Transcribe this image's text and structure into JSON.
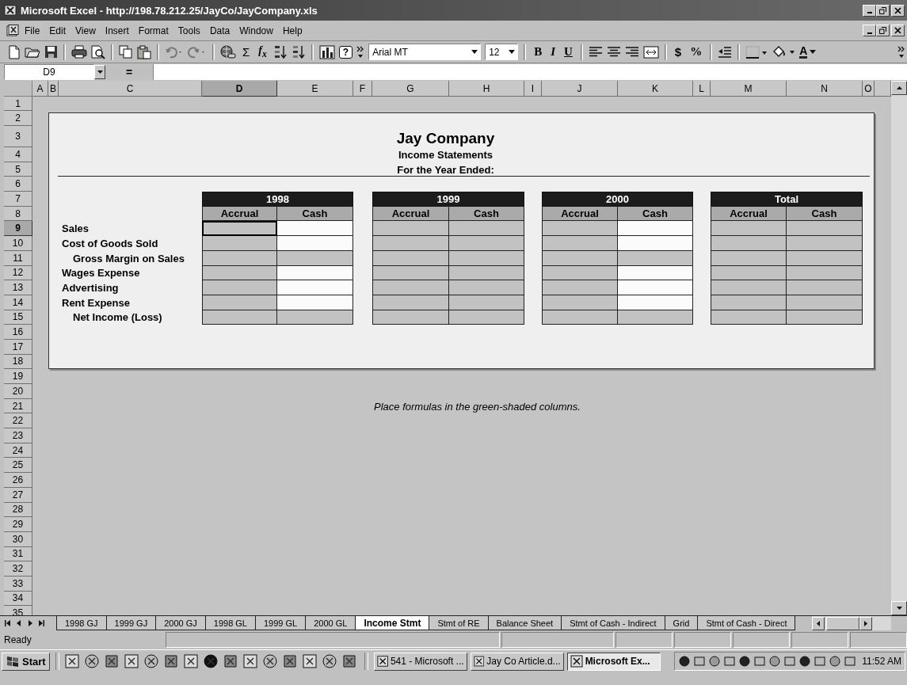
{
  "window": {
    "title": "Microsoft Excel - http://198.78.212.25/JayCo/JayCompany.xls"
  },
  "menu": [
    "File",
    "Edit",
    "View",
    "Insert",
    "Format",
    "Tools",
    "Data",
    "Window",
    "Help"
  ],
  "toolbar": {
    "sum": "Σ",
    "function": "f$_{x}$",
    "help": "?",
    "font": "Arial MT",
    "size": "12",
    "bold": "B",
    "italic": "I",
    "underline": "U",
    "currency": "$",
    "percent": "%",
    "font_color": "A"
  },
  "formula_bar": {
    "name_box": "D9",
    "equals": "="
  },
  "columns": [
    {
      "label": "A",
      "selected": false
    },
    {
      "label": "B",
      "selected": false
    },
    {
      "label": "C",
      "selected": false
    },
    {
      "label": "D",
      "selected": true
    },
    {
      "label": "E",
      "selected": false
    },
    {
      "label": "F",
      "selected": false
    },
    {
      "label": "G",
      "selected": false
    },
    {
      "label": "H",
      "selected": false
    },
    {
      "label": "I",
      "selected": false
    },
    {
      "label": "J",
      "selected": false
    },
    {
      "label": "K",
      "selected": false
    },
    {
      "label": "L",
      "selected": false
    },
    {
      "label": "M",
      "selected": false
    },
    {
      "label": "N",
      "selected": false
    },
    {
      "label": "O",
      "selected": false
    }
  ],
  "rows": [
    {
      "label": "1",
      "selected": false
    },
    {
      "label": "2",
      "selected": false
    },
    {
      "label": "3",
      "selected": false
    },
    {
      "label": "4",
      "selected": false
    },
    {
      "label": "5",
      "selected": false
    },
    {
      "label": "6",
      "selected": false
    },
    {
      "label": "7",
      "selected": false
    },
    {
      "label": "8",
      "selected": false
    },
    {
      "label": "9",
      "selected": true
    },
    {
      "label": "10",
      "selected": false
    },
    {
      "label": "11",
      "selected": false
    },
    {
      "label": "12",
      "selected": false
    },
    {
      "label": "13",
      "selected": false
    },
    {
      "label": "14",
      "selected": false
    },
    {
      "label": "15",
      "selected": false
    },
    {
      "label": "16",
      "selected": false
    },
    {
      "label": "17",
      "selected": false
    },
    {
      "label": "18",
      "selected": false
    },
    {
      "label": "19",
      "selected": false
    },
    {
      "label": "20",
      "selected": false
    },
    {
      "label": "21",
      "selected": false
    },
    {
      "label": "22",
      "selected": false
    },
    {
      "label": "23",
      "selected": false
    },
    {
      "label": "24",
      "selected": false
    },
    {
      "label": "25",
      "selected": false
    },
    {
      "label": "26",
      "selected": false
    },
    {
      "label": "27",
      "selected": false
    },
    {
      "label": "28",
      "selected": false
    },
    {
      "label": "29",
      "selected": false
    },
    {
      "label": "30",
      "selected": false
    },
    {
      "label": "31",
      "selected": false
    },
    {
      "label": "32",
      "selected": false
    },
    {
      "label": "33",
      "selected": false
    },
    {
      "label": "34",
      "selected": false
    },
    {
      "label": "35",
      "selected": false
    }
  ],
  "report": {
    "title": "Jay Company",
    "subtitle": "Income Statements",
    "period": "For the Year Ended:",
    "line_items": [
      {
        "label": "Sales",
        "indented": false
      },
      {
        "label": "Cost of Goods Sold",
        "indented": false
      },
      {
        "label": "Gross Margin on Sales",
        "indented": true
      },
      {
        "label": "Wages Expense",
        "indented": false
      },
      {
        "label": "Advertising",
        "indented": false
      },
      {
        "label": "Rent Expense",
        "indented": false
      },
      {
        "label": "Net Income (Loss)",
        "indented": true
      }
    ],
    "tables": [
      {
        "year": "1998",
        "headers": [
          "Accrual",
          "Cash"
        ],
        "rows": [
          {
            "cells": [
              {
                "shaded": true,
                "selected": true
              },
              {
                "shaded": false,
                "selected": false
              }
            ]
          },
          {
            "cells": [
              {
                "shaded": true,
                "selected": false
              },
              {
                "shaded": false,
                "selected": false
              }
            ]
          },
          {
            "cells": [
              {
                "shaded": true,
                "selected": false
              },
              {
                "shaded": true,
                "selected": false
              }
            ]
          },
          {
            "cells": [
              {
                "shaded": true,
                "selected": false
              },
              {
                "shaded": false,
                "selected": false
              }
            ]
          },
          {
            "cells": [
              {
                "shaded": true,
                "selected": false
              },
              {
                "shaded": false,
                "selected": false
              }
            ]
          },
          {
            "cells": [
              {
                "shaded": true,
                "selected": false
              },
              {
                "shaded": false,
                "selected": false
              }
            ]
          },
          {
            "cells": [
              {
                "shaded": true,
                "selected": false
              },
              {
                "shaded": true,
                "selected": false
              }
            ]
          }
        ]
      },
      {
        "year": "1999",
        "headers": [
          "Accrual",
          "Cash"
        ],
        "rows": [
          {
            "cells": [
              {
                "shaded": true,
                "selected": false
              },
              {
                "shaded": true,
                "selected": false
              }
            ]
          },
          {
            "cells": [
              {
                "shaded": true,
                "selected": false
              },
              {
                "shaded": true,
                "selected": false
              }
            ]
          },
          {
            "cells": [
              {
                "shaded": true,
                "selected": false
              },
              {
                "shaded": true,
                "selected": false
              }
            ]
          },
          {
            "cells": [
              {
                "shaded": true,
                "selected": false
              },
              {
                "shaded": true,
                "selected": false
              }
            ]
          },
          {
            "cells": [
              {
                "shaded": true,
                "selected": false
              },
              {
                "shaded": true,
                "selected": false
              }
            ]
          },
          {
            "cells": [
              {
                "shaded": true,
                "selected": false
              },
              {
                "shaded": true,
                "selected": false
              }
            ]
          },
          {
            "cells": [
              {
                "shaded": true,
                "selected": false
              },
              {
                "shaded": true,
                "selected": false
              }
            ]
          }
        ]
      },
      {
        "year": "2000",
        "headers": [
          "Accrual",
          "Cash"
        ],
        "rows": [
          {
            "cells": [
              {
                "shaded": true,
                "selected": false
              },
              {
                "shaded": false,
                "selected": false
              }
            ]
          },
          {
            "cells": [
              {
                "shaded": true,
                "selected": false
              },
              {
                "shaded": false,
                "selected": false
              }
            ]
          },
          {
            "cells": [
              {
                "shaded": true,
                "selected": false
              },
              {
                "shaded": true,
                "selected": false
              }
            ]
          },
          {
            "cells": [
              {
                "shaded": true,
                "selected": false
              },
              {
                "shaded": false,
                "selected": false
              }
            ]
          },
          {
            "cells": [
              {
                "shaded": true,
                "selected": false
              },
              {
                "shaded": false,
                "selected": false
              }
            ]
          },
          {
            "cells": [
              {
                "shaded": true,
                "selected": false
              },
              {
                "shaded": false,
                "selected": false
              }
            ]
          },
          {
            "cells": [
              {
                "shaded": true,
                "selected": false
              },
              {
                "shaded": true,
                "selected": false
              }
            ]
          }
        ]
      },
      {
        "year": "Total",
        "headers": [
          "Accrual",
          "Cash"
        ],
        "rows": [
          {
            "cells": [
              {
                "shaded": true,
                "selected": false
              },
              {
                "shaded": true,
                "selected": false
              }
            ]
          },
          {
            "cells": [
              {
                "shaded": true,
                "selected": false
              },
              {
                "shaded": true,
                "selected": false
              }
            ]
          },
          {
            "cells": [
              {
                "shaded": true,
                "selected": false
              },
              {
                "shaded": true,
                "selected": false
              }
            ]
          },
          {
            "cells": [
              {
                "shaded": true,
                "selected": false
              },
              {
                "shaded": true,
                "selected": false
              }
            ]
          },
          {
            "cells": [
              {
                "shaded": true,
                "selected": false
              },
              {
                "shaded": true,
                "selected": false
              }
            ]
          },
          {
            "cells": [
              {
                "shaded": true,
                "selected": false
              },
              {
                "shaded": true,
                "selected": false
              }
            ]
          },
          {
            "cells": [
              {
                "shaded": true,
                "selected": false
              },
              {
                "shaded": true,
                "selected": false
              }
            ]
          }
        ]
      }
    ]
  },
  "note": "Place formulas in the green-shaded columns.",
  "sheet_tabs": [
    {
      "label": "1998 GJ",
      "selected": false
    },
    {
      "label": "1999 GJ",
      "selected": false
    },
    {
      "label": "2000 GJ",
      "selected": false
    },
    {
      "label": "1998 GL",
      "selected": false
    },
    {
      "label": "1999 GL",
      "selected": false
    },
    {
      "label": "2000 GL",
      "selected": false
    },
    {
      "label": "Income Stmt",
      "selected": true
    },
    {
      "label": "Stmt of RE",
      "selected": false
    },
    {
      "label": "Balance Sheet",
      "selected": false
    },
    {
      "label": "Stmt of Cash - Indirect",
      "selected": false
    },
    {
      "label": "Grid",
      "selected": false
    },
    {
      "label": "Stmt of Cash - Direct",
      "selected": false
    }
  ],
  "status_bar": {
    "text": "Ready"
  },
  "taskbar": {
    "start": "Start",
    "tasks": [
      {
        "label": "541 - Microsoft ...",
        "selected": false
      },
      {
        "label": "Jay Co Article.d...",
        "selected": false
      },
      {
        "label": "Microsoft Ex...",
        "selected": true
      }
    ],
    "clock": "11:52 AM"
  }
}
